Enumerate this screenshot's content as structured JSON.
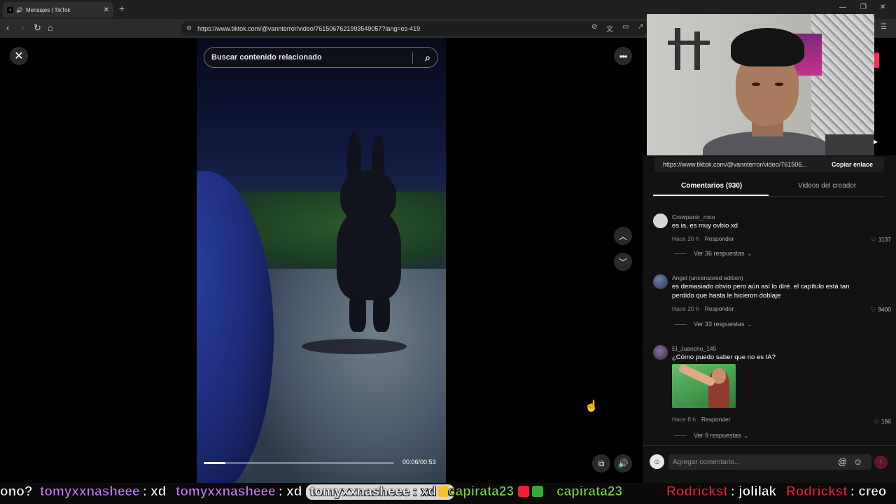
{
  "browser": {
    "tab_title": "Mensajes | TikTok",
    "url": "https://www.tiktok.com/@vannterror/video/7615067621993549057?lang=es-419"
  },
  "search": {
    "placeholder": "Buscar contenido relacionado"
  },
  "player": {
    "time": "00:06/00:53",
    "progress_fraction": 0.113
  },
  "share": {
    "url": "https://www.tiktok.com/@vannterror/video/761506...",
    "copy_label": "Copiar enlace"
  },
  "tabs": {
    "comments": "Comentarios (930)",
    "creator_videos": "Videos del creador"
  },
  "comments": [
    {
      "user": "Crowpanic_mno",
      "text": "es ia, es muy ovbio xd",
      "time": "Hace 20 h",
      "reply_label": "Responder",
      "likes": "1137",
      "replies": "Ver 36 respuestas"
    },
    {
      "user": "Angel (uncensored edition)",
      "text": "es demasiado obvio pero aún así lo diré. el capítulo está tan perdido que hasta le hicieron doblaje",
      "time": "Hace 20 h",
      "reply_label": "Responder",
      "likes": "9400",
      "replies": "Ver 33 respuestas"
    },
    {
      "user": "El_Juancho_145",
      "text": "¿Cómo puedo saber que no es IA?",
      "time": "Hace 8 h",
      "reply_label": "Responder",
      "likes": "196",
      "replies": "Ver 9 respuestas"
    }
  ],
  "comment_box": {
    "placeholder": "Agregar comentario..."
  },
  "chat": [
    {
      "user": "ono?",
      "text": ""
    },
    {
      "user": "tomyxxnasheee",
      "text": ": xd"
    },
    {
      "user": "tomyxxnasheee",
      "text": ": xd"
    },
    {
      "user": "tomyxxnasheee",
      "text": ": xd"
    },
    {
      "user": "capirata23",
      "text": ""
    },
    {
      "user": "capirata23",
      "text": ": jolilak"
    },
    {
      "user": "Rodrickst",
      "text": ""
    },
    {
      "user": "Rodrickst",
      "text": ": creo"
    }
  ],
  "colors": {
    "accent": "#fe2c55",
    "chat_user_purple": "#c47af2",
    "chat_user_green": "#7cd63a",
    "chat_user_red": "#e0203a"
  }
}
